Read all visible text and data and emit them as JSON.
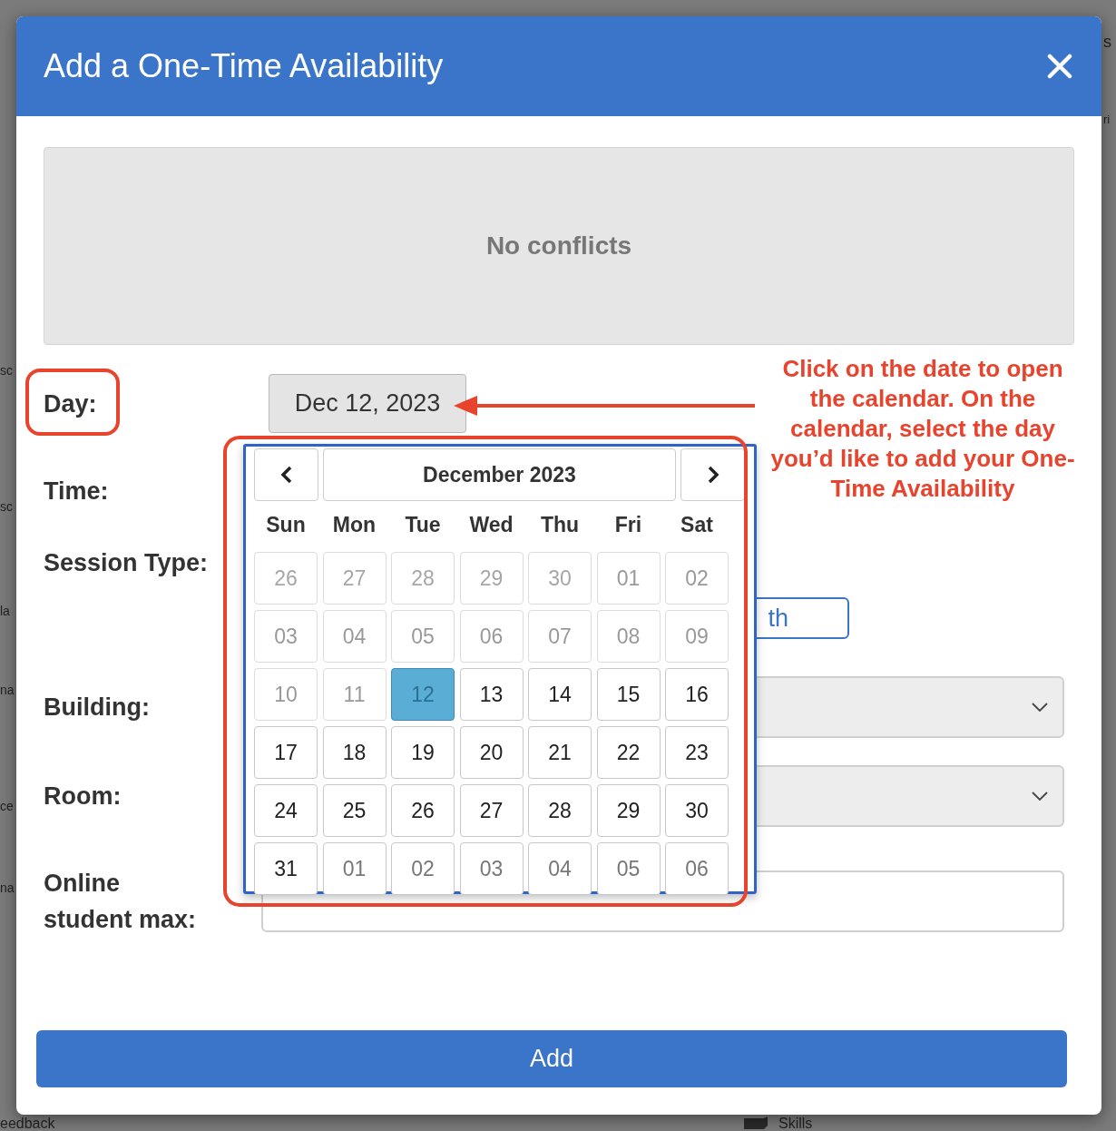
{
  "background": {
    "left_fragments": [
      {
        "text": "sc"
      },
      {
        "text": "sc"
      },
      {
        "text": "la"
      },
      {
        "text": "na"
      },
      {
        "text": "ce"
      },
      {
        "text": "na"
      }
    ],
    "right_fragments": [
      {
        "text": "s"
      },
      {
        "text": "ri"
      }
    ],
    "bottom_left": "eedback",
    "bottom_right": "Skills"
  },
  "dialog": {
    "title": "Add a One-Time Availability"
  },
  "conflicts": "No conflicts",
  "fields": [
    {
      "kind": "date",
      "label": "Day:",
      "value": "Dec 12, 2023",
      "highlighted": true
    },
    {
      "kind": "blank",
      "label": "Time:",
      "highlighted": false
    },
    {
      "kind": "choice",
      "label": "Session Type:",
      "value": "th",
      "highlighted": false
    },
    {
      "kind": "select",
      "label": "Building:",
      "highlighted": false
    },
    {
      "kind": "select",
      "label": "Room:",
      "highlighted": false
    },
    {
      "kind": "text",
      "label": "Online student max:",
      "highlighted": false
    }
  ],
  "calendar": {
    "month": "December 2023",
    "highlighted": true,
    "weekdays": [
      "Sun",
      "Mon",
      "Tue",
      "Wed",
      "Thu",
      "Fri",
      "Sat"
    ],
    "weeks": [
      [
        {
          "day": "26",
          "disabled": true,
          "outside_month": true,
          "selected": false
        },
        {
          "day": "27",
          "disabled": true,
          "outside_month": true,
          "selected": false
        },
        {
          "day": "28",
          "disabled": true,
          "outside_month": true,
          "selected": false
        },
        {
          "day": "29",
          "disabled": true,
          "outside_month": true,
          "selected": false
        },
        {
          "day": "30",
          "disabled": true,
          "outside_month": true,
          "selected": false
        },
        {
          "day": "01",
          "disabled": true,
          "outside_month": false,
          "selected": false
        },
        {
          "day": "02",
          "disabled": true,
          "outside_month": false,
          "selected": false
        }
      ],
      [
        {
          "day": "03",
          "disabled": true,
          "outside_month": false,
          "selected": false
        },
        {
          "day": "04",
          "disabled": true,
          "outside_month": false,
          "selected": false
        },
        {
          "day": "05",
          "disabled": true,
          "outside_month": false,
          "selected": false
        },
        {
          "day": "06",
          "disabled": true,
          "outside_month": false,
          "selected": false
        },
        {
          "day": "07",
          "disabled": true,
          "outside_month": false,
          "selected": false
        },
        {
          "day": "08",
          "disabled": true,
          "outside_month": false,
          "selected": false
        },
        {
          "day": "09",
          "disabled": true,
          "outside_month": false,
          "selected": false
        }
      ],
      [
        {
          "day": "10",
          "disabled": true,
          "outside_month": false,
          "selected": false
        },
        {
          "day": "11",
          "disabled": true,
          "outside_month": false,
          "selected": false
        },
        {
          "day": "12",
          "disabled": false,
          "outside_month": false,
          "selected": true
        },
        {
          "day": "13",
          "disabled": false,
          "outside_month": false,
          "selected": false
        },
        {
          "day": "14",
          "disabled": false,
          "outside_month": false,
          "selected": false
        },
        {
          "day": "15",
          "disabled": false,
          "outside_month": false,
          "selected": false
        },
        {
          "day": "16",
          "disabled": false,
          "outside_month": false,
          "selected": false
        }
      ],
      [
        {
          "day": "17",
          "disabled": false,
          "outside_month": false,
          "selected": false
        },
        {
          "day": "18",
          "disabled": false,
          "outside_month": false,
          "selected": false
        },
        {
          "day": "19",
          "disabled": false,
          "outside_month": false,
          "selected": false
        },
        {
          "day": "20",
          "disabled": false,
          "outside_month": false,
          "selected": false
        },
        {
          "day": "21",
          "disabled": false,
          "outside_month": false,
          "selected": false
        },
        {
          "day": "22",
          "disabled": false,
          "outside_month": false,
          "selected": false
        },
        {
          "day": "23",
          "disabled": false,
          "outside_month": false,
          "selected": false
        }
      ],
      [
        {
          "day": "24",
          "disabled": false,
          "outside_month": false,
          "selected": false
        },
        {
          "day": "25",
          "disabled": false,
          "outside_month": false,
          "selected": false
        },
        {
          "day": "26",
          "disabled": false,
          "outside_month": false,
          "selected": false
        },
        {
          "day": "27",
          "disabled": false,
          "outside_month": false,
          "selected": false
        },
        {
          "day": "28",
          "disabled": false,
          "outside_month": false,
          "selected": false
        },
        {
          "day": "29",
          "disabled": false,
          "outside_month": false,
          "selected": false
        },
        {
          "day": "30",
          "disabled": false,
          "outside_month": false,
          "selected": false
        }
      ],
      [
        {
          "day": "31",
          "disabled": false,
          "outside_month": false,
          "selected": false
        },
        {
          "day": "01",
          "disabled": false,
          "outside_month": true,
          "selected": false
        },
        {
          "day": "02",
          "disabled": false,
          "outside_month": true,
          "selected": false
        },
        {
          "day": "03",
          "disabled": false,
          "outside_month": true,
          "selected": false
        },
        {
          "day": "04",
          "disabled": false,
          "outside_month": true,
          "selected": false
        },
        {
          "day": "05",
          "disabled": false,
          "outside_month": true,
          "selected": false
        },
        {
          "day": "06",
          "disabled": false,
          "outside_month": true,
          "selected": false
        }
      ]
    ]
  },
  "annotation": {
    "text": "Click on the date to open the calendar. On the calendar, select the day you’d like to add your One-Time Availability"
  },
  "submit": "Add"
}
